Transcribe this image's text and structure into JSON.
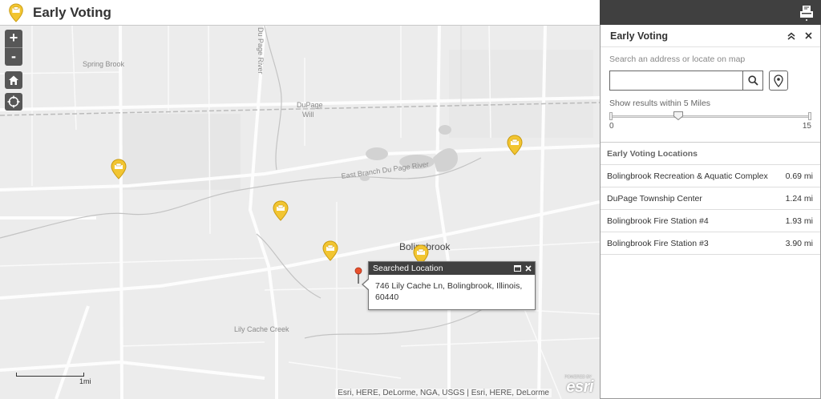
{
  "header": {
    "title": "Early Voting"
  },
  "map": {
    "zoom_in_label": "+",
    "zoom_out_label": "-",
    "labels": {
      "spring_brook": "Spring Brook",
      "dupage_river": "Du Page River",
      "dupage": "DuPage",
      "will": "Will",
      "east_branch": "East Branch Du Page River",
      "bolingbrook": "Bolingbrook",
      "lily_cache_creek": "Lily Cache Creek"
    },
    "scale_label": "1mi",
    "attribution": "Esri, HERE, DeLorme, NGA, USGS | Esri, HERE, DeLorme",
    "esri_powered": "POWERED BY",
    "esri_logo": "esri"
  },
  "popup": {
    "title": "Searched Location",
    "address": "746 Lily Cache Ln, Bolingbrook, Illinois, 60440"
  },
  "panel": {
    "title": "Early Voting",
    "search_hint": "Search an address or locate on map",
    "search_value": "",
    "search_placeholder": "",
    "radius_text": "Show results within 5 Miles",
    "slider": {
      "min_label": "0",
      "max_label": "15",
      "value": 5,
      "min": 0,
      "max": 15
    },
    "list_header": "Early Voting Locations",
    "locations": [
      {
        "name": "Bolingbrook Recreation & Aquatic Complex",
        "distance": "0.69 mi"
      },
      {
        "name": "DuPage Township Center",
        "distance": "1.24 mi"
      },
      {
        "name": "Bolingbrook Fire Station #4",
        "distance": "1.93 mi"
      },
      {
        "name": "Bolingbrook Fire Station #3",
        "distance": "3.90 mi"
      }
    ]
  },
  "colors": {
    "marker": "#f2c531",
    "marker_stroke": "#c89a10",
    "header_dark": "#404040",
    "pin": "#e8502c"
  },
  "icons": {
    "app_logo": "ballot-marker-icon",
    "voting_marker": "ballot-box-icon",
    "search": "search-icon",
    "locate": "location-pin-icon",
    "home": "home-icon",
    "gps": "crosshair-icon",
    "collapse": "double-chevron-up-icon",
    "close": "close-icon",
    "maximize": "maximize-icon",
    "widget": "ballot-box-icon"
  }
}
